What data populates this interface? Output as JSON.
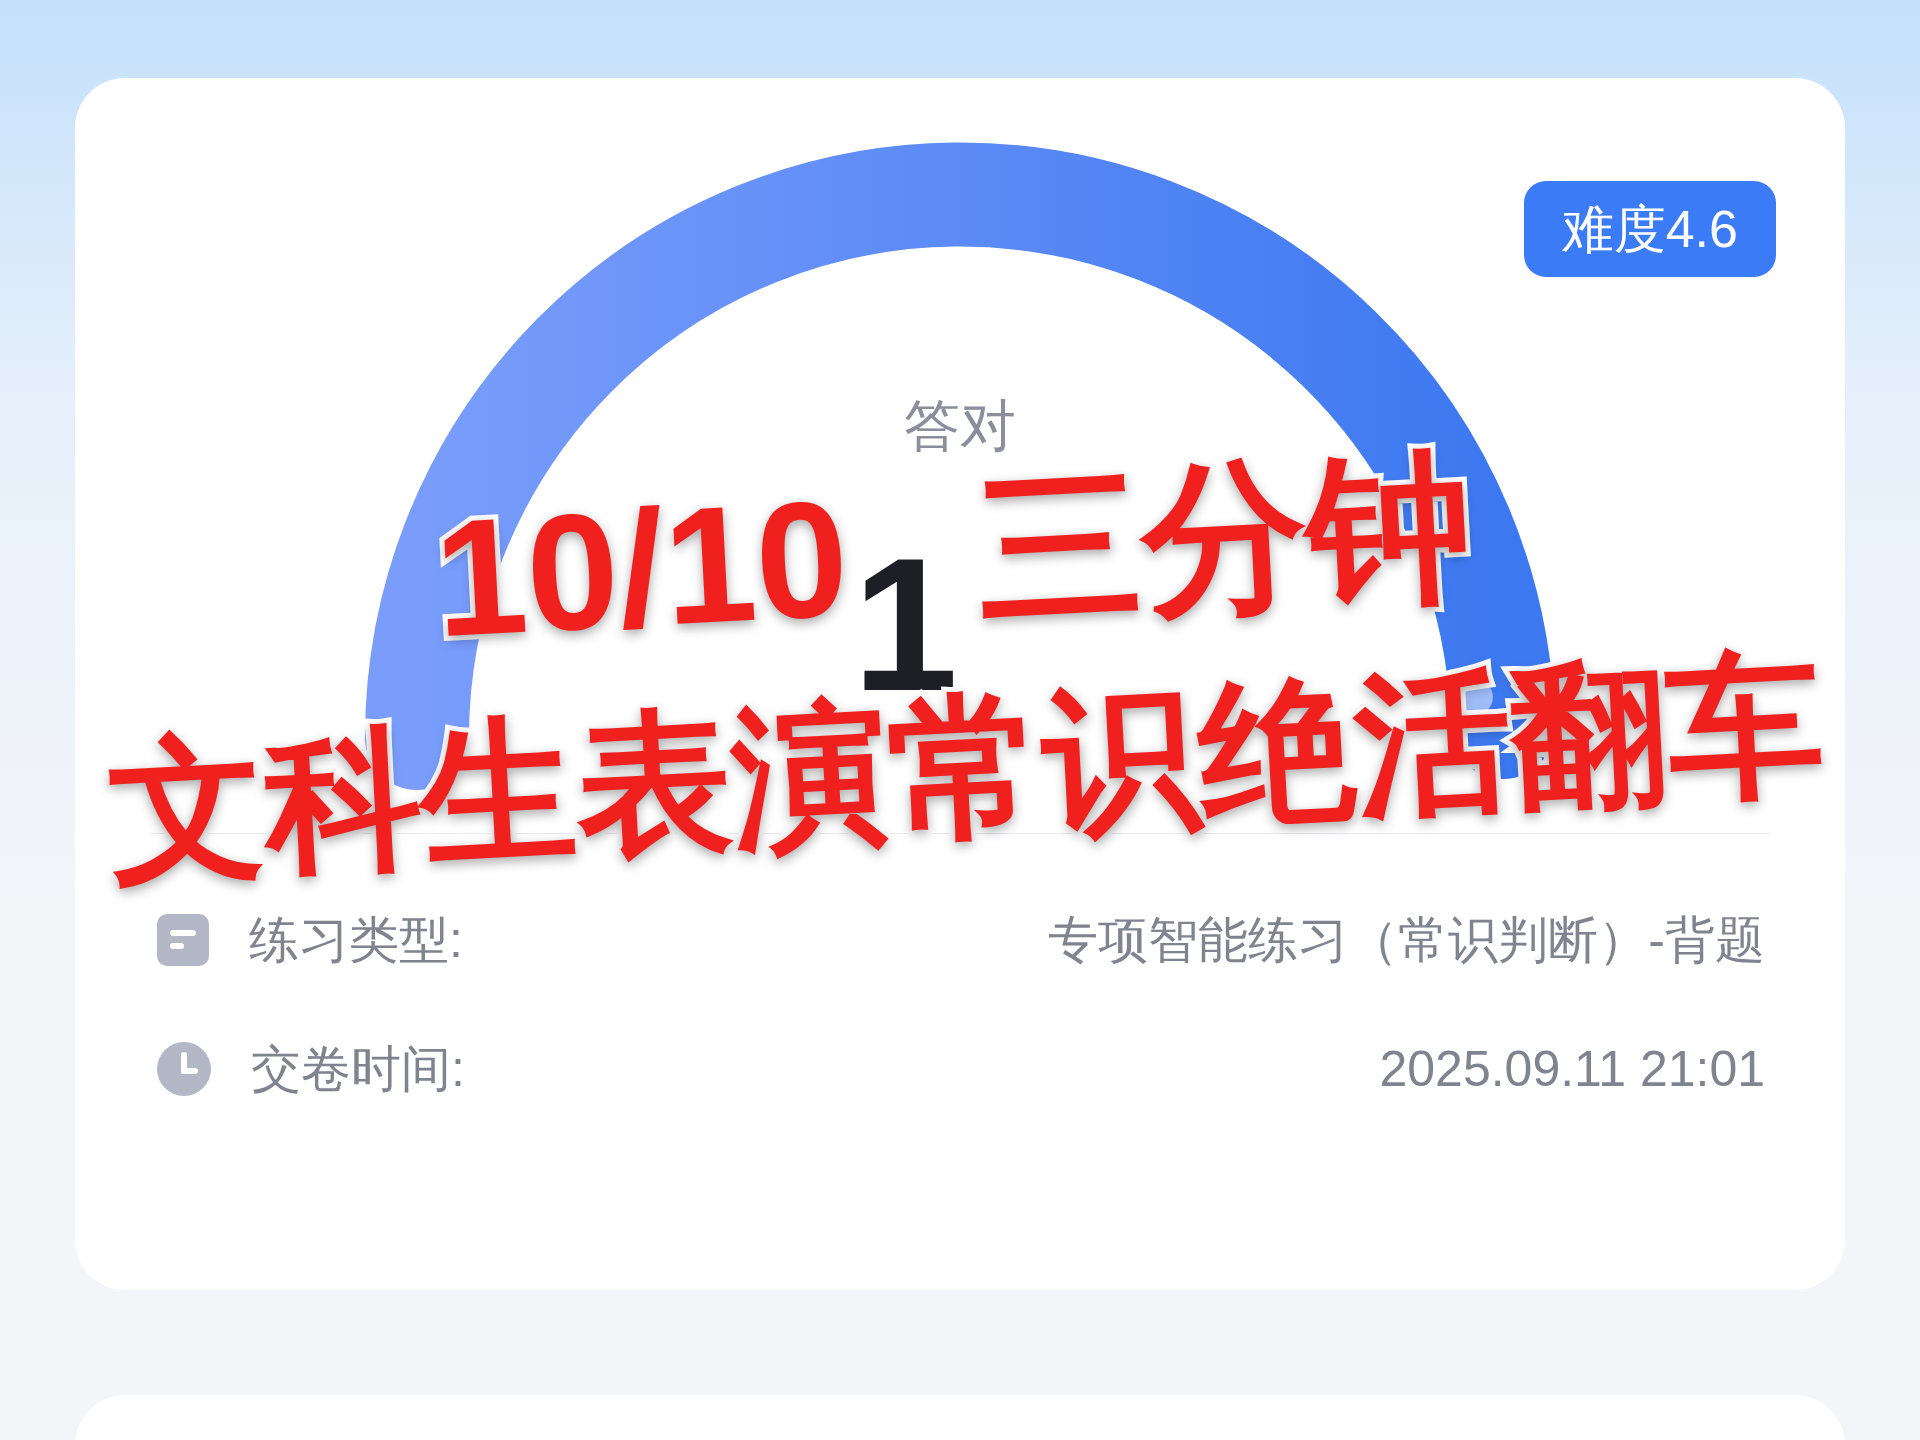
{
  "badge": "难度4.6",
  "gauge": {
    "label": "答对",
    "value": "1"
  },
  "details": [
    {
      "kind": "document",
      "label": "练习类型:",
      "value": "专项智能练习（常识判断）-背题"
    },
    {
      "kind": "clock",
      "label": "交卷时间:",
      "value": "2025.09.11 21:01"
    }
  ],
  "caption_top": [
    "10/10",
    "三分钟"
  ],
  "caption_bottom": "文科生表演常识绝活翻车"
}
